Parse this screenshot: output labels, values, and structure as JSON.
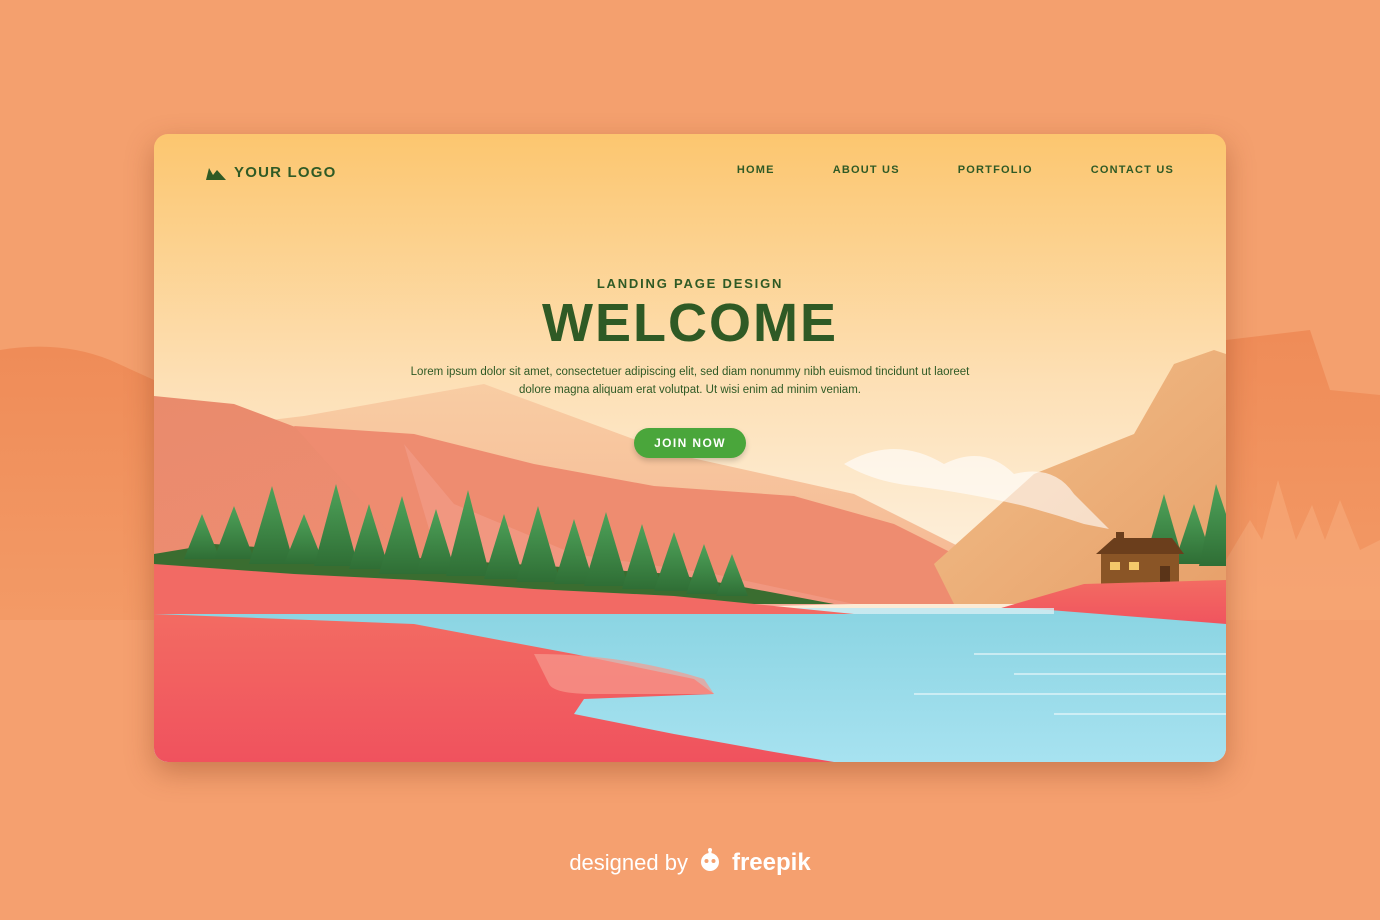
{
  "brand": {
    "logo_text": "YOUR LOGO",
    "logo_icon": "mountain-logo-icon"
  },
  "nav": {
    "items": [
      {
        "label": "HOME"
      },
      {
        "label": "ABOUT US"
      },
      {
        "label": "PORTFOLIO"
      },
      {
        "label": "CONTACT US"
      }
    ]
  },
  "hero": {
    "eyebrow": "LANDING PAGE DESIGN",
    "headline": "WELCOME",
    "description": "Lorem ipsum dolor sit amet, consectetuer adipiscing elit, sed diam nonummy nibh euismod tincidunt ut laoreet dolore magna aliquam erat volutpat. Ut wisi enim ad minim veniam.",
    "cta_label": "JOIN NOW"
  },
  "credit": {
    "prefix": "designed by",
    "brand": "freepik",
    "brand_icon": "freepik-robot-icon"
  },
  "colors": {
    "page_background": "#f4a06e",
    "text_green": "#2f5a25",
    "cta_green": "#4aa63b",
    "lake": "#8fd6e3",
    "pink_hills": "#f15f61"
  }
}
